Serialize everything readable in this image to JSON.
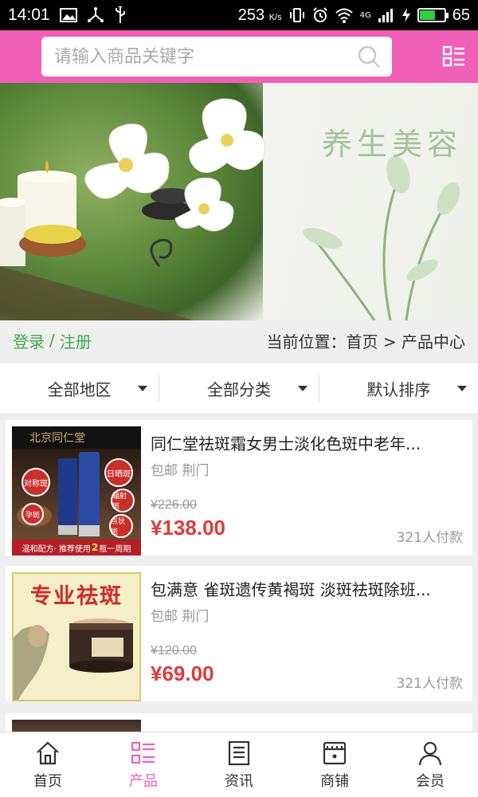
{
  "status_bar": {
    "time": "14:01",
    "speed_value": "253",
    "speed_unit": "K/s",
    "network": "4G",
    "battery_level": 0.65,
    "battery_percent": "65",
    "left_icons": [
      "image-icon",
      "usb-share-icon",
      "usb-icon"
    ],
    "right_icons": [
      "vibrate-icon",
      "alarm-icon",
      "wifi-icon",
      "signal-icon",
      "charging-icon",
      "battery-icon"
    ]
  },
  "header": {
    "search_placeholder": "请输入商品关键字",
    "search_icon": "search-icon",
    "menu_icon": "grid-menu-icon",
    "brand_color": "#f05fb8"
  },
  "banner": {
    "title": "养生美容"
  },
  "nav_bar": {
    "login": "登录",
    "separator": "/",
    "register": "注册",
    "location": "当前位置：首页 > 产品中心"
  },
  "filters": [
    {
      "label": "全部地区"
    },
    {
      "label": "全部分类"
    },
    {
      "label": "默认排序"
    }
  ],
  "products": [
    {
      "title": "同仁堂祛斑霜女男士淡化色斑中老年...",
      "tags": "包邮 荆门",
      "original_price": "¥226.00",
      "price": "¥138.00",
      "sold": "321人付款",
      "thumb": {
        "brand": "北京同仁堂",
        "badge1": "对称斑",
        "badge2": "日晒斑",
        "badge3": "辐射斑",
        "badge4": "孕斑",
        "badge5": "点状斑",
        "footer_left": "温和配方",
        "footer_mid": "· 推荐使用",
        "footer_num": "2",
        "footer_right": "瓶一周期"
      }
    },
    {
      "title": "包满意 雀斑遗传黄褐斑 淡斑祛斑除班...",
      "tags": "包邮 荆门",
      "original_price": "¥120.00",
      "price": "¥69.00",
      "sold": "321人付款",
      "thumb": {
        "headline": "专业祛斑"
      }
    }
  ],
  "bottom_nav": [
    {
      "label": "首页",
      "icon": "home-icon",
      "active": false
    },
    {
      "label": "产品",
      "icon": "product-list-icon",
      "active": true
    },
    {
      "label": "资讯",
      "icon": "news-icon",
      "active": false
    },
    {
      "label": "商铺",
      "icon": "shop-icon",
      "active": false
    },
    {
      "label": "会员",
      "icon": "user-icon",
      "active": false
    }
  ],
  "colors": {
    "accent": "#f05fb8",
    "price": "#e03a3a",
    "login": "#3ea84a"
  }
}
